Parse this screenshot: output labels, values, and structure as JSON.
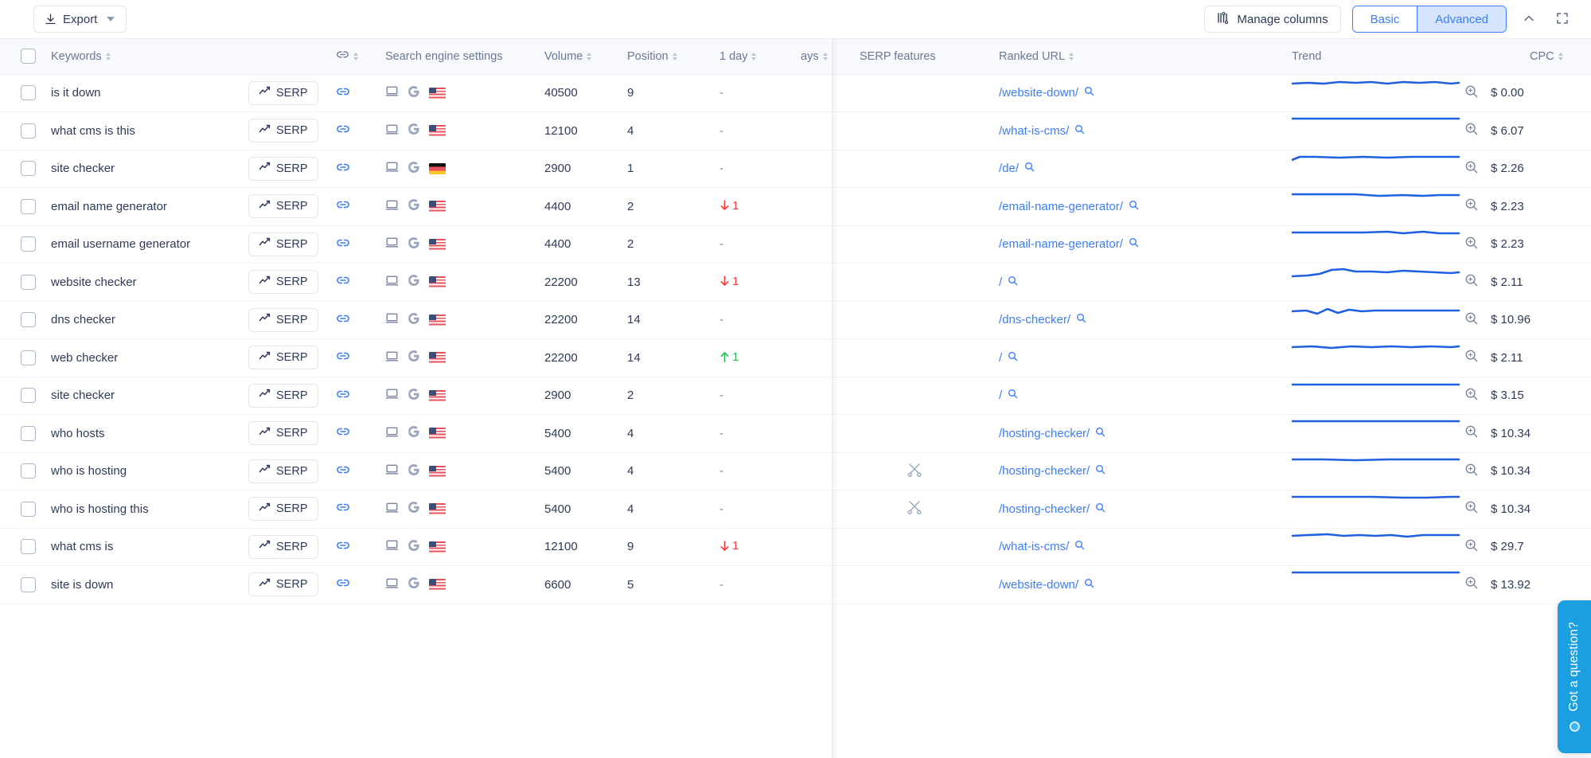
{
  "toolbar": {
    "export_label": "Export",
    "manage_columns_label": "Manage columns",
    "view_basic_label": "Basic",
    "view_advanced_label": "Advanced",
    "active_view": "Advanced",
    "collapse_title": "Collapse",
    "fullscreen_title": "Fullscreen",
    "accent_color": "#3b7dfb",
    "accent_bg": "#d6e4fe"
  },
  "table": {
    "columns": [
      {
        "key": "checkbox",
        "label": "",
        "sortable": false
      },
      {
        "key": "keywords",
        "label": "Keywords",
        "sortable": true
      },
      {
        "key": "serp",
        "label": "",
        "sortable": false
      },
      {
        "key": "link",
        "label": "link-icon",
        "sortable": true
      },
      {
        "key": "search_engine_settings",
        "label": "Search engine settings",
        "sortable": false
      },
      {
        "key": "volume",
        "label": "Volume",
        "sortable": true
      },
      {
        "key": "position",
        "label": "Position",
        "sortable": true
      },
      {
        "key": "one_day",
        "label": "1 day",
        "sortable": true
      },
      {
        "key": "n_days",
        "label": "ays",
        "sortable": true
      },
      {
        "key": "serp_features",
        "label": "SERP features",
        "sortable": false
      },
      {
        "key": "ranked_url",
        "label": "Ranked URL",
        "sortable": true
      },
      {
        "key": "trend",
        "label": "Trend",
        "sortable": false
      },
      {
        "key": "cpc",
        "label": "CPC",
        "sortable": true
      }
    ],
    "serp_button_label": "SERP",
    "rows": [
      {
        "keyword": "is it down",
        "device": "desktop",
        "engine": "G",
        "country": "us",
        "volume": "40500",
        "position": "9",
        "one_day": "-",
        "dir": "none",
        "serp_features": "",
        "url": "/website-down/",
        "cpc": "$ 0.00",
        "trend": "0,9 20,8 40,9 60,7 80,8 100,7 120,9 140,7 160,8 180,7 200,9 210,8"
      },
      {
        "keyword": "what cms is this",
        "device": "desktop",
        "engine": "G",
        "country": "us",
        "volume": "12100",
        "position": "4",
        "one_day": "-",
        "dir": "none",
        "serp_features": "",
        "url": "/what-is-cms/",
        "cpc": "$ 6.07",
        "trend": "0,6 30,6 60,6 90,6 120,6 150,6 180,6 210,6"
      },
      {
        "keyword": "site checker",
        "device": "desktop",
        "engine": "G",
        "country": "de",
        "volume": "2900",
        "position": "1",
        "one_day": "-",
        "dir": "none",
        "serp_features": "",
        "url": "/de/",
        "cpc": "$ 2.26",
        "trend": "0,10 10,6 30,6 60,7 90,6 120,7 150,6 180,6 210,6"
      },
      {
        "keyword": "email name generator",
        "device": "desktop",
        "engine": "G",
        "country": "us",
        "volume": "4400",
        "position": "2",
        "one_day": "1",
        "dir": "down",
        "serp_features": "",
        "url": "/email-name-generator/",
        "cpc": "$ 2.23",
        "trend": "0,6 40,6 80,6 110,8 140,7 165,8 185,7 210,7"
      },
      {
        "keyword": "email username generator",
        "device": "desktop",
        "engine": "G",
        "country": "us",
        "volume": "4400",
        "position": "2",
        "one_day": "-",
        "dir": "none",
        "serp_features": "",
        "url": "/email-name-generator/",
        "cpc": "$ 2.23",
        "trend": "0,6 50,6 90,6 120,5 140,7 165,5 185,7 210,7"
      },
      {
        "keyword": "website checker",
        "device": "desktop",
        "engine": "G",
        "country": "us",
        "volume": "22200",
        "position": "13",
        "one_day": "1",
        "dir": "down",
        "serp_features": "",
        "url": "/",
        "cpc": "$ 2.11",
        "trend": "0,14 20,13 35,11 50,6 65,5 80,8 100,8 120,9 140,7 160,8 180,9 200,10 210,9"
      },
      {
        "keyword": "dns checker",
        "device": "desktop",
        "engine": "G",
        "country": "us",
        "volume": "22200",
        "position": "14",
        "one_day": "-",
        "dir": "none",
        "serp_features": "",
        "url": "/dns-checker/",
        "cpc": "$ 10.96",
        "trend": "0,10 18,9 32,13 45,7 58,12 72,8 88,10 105,9 125,9 150,9 175,9 200,9 210,9"
      },
      {
        "keyword": "web checker",
        "device": "desktop",
        "engine": "G",
        "country": "us",
        "volume": "22200",
        "position": "14",
        "one_day": "1",
        "dir": "up",
        "serp_features": "",
        "url": "/",
        "cpc": "$ 2.11",
        "trend": "0,8 25,7 50,9 75,7 100,8 125,7 150,8 175,7 200,8 210,7"
      },
      {
        "keyword": "site checker",
        "device": "desktop",
        "engine": "G",
        "country": "us",
        "volume": "2900",
        "position": "2",
        "one_day": "-",
        "dir": "none",
        "serp_features": "",
        "url": "/",
        "cpc": "$ 3.15",
        "trend": "0,7 40,7 80,7 120,7 160,7 200,7 210,7"
      },
      {
        "keyword": "who hosts",
        "device": "desktop",
        "engine": "G",
        "country": "us",
        "volume": "5400",
        "position": "4",
        "one_day": "-",
        "dir": "none",
        "serp_features": "",
        "url": "/hosting-checker/",
        "cpc": "$ 10.34",
        "trend": "0,6 50,6 100,6 150,6 200,6 210,6"
      },
      {
        "keyword": "who is hosting",
        "device": "desktop",
        "engine": "G",
        "country": "us",
        "volume": "5400",
        "position": "4",
        "one_day": "-",
        "dir": "none",
        "serp_features": "scissors",
        "url": "/hosting-checker/",
        "cpc": "$ 10.34",
        "trend": "0,6 40,6 80,7 120,6 160,6 200,6 210,6"
      },
      {
        "keyword": "who is hosting this",
        "device": "desktop",
        "engine": "G",
        "country": "us",
        "volume": "5400",
        "position": "4",
        "one_day": "-",
        "dir": "none",
        "serp_features": "scissors",
        "url": "/hosting-checker/",
        "cpc": "$ 10.34",
        "trend": "0,6 50,6 100,6 140,7 170,7 200,6 210,6"
      },
      {
        "keyword": "what cms is",
        "device": "desktop",
        "engine": "G",
        "country": "us",
        "volume": "12100",
        "position": "9",
        "one_day": "1",
        "dir": "down",
        "serp_features": "",
        "url": "/what-is-cms/",
        "cpc": "$ 29.7",
        "trend": "0,7 20,6 45,5 65,7 85,6 105,7 125,6 145,8 165,6 185,6 205,6 210,6"
      },
      {
        "keyword": "site is down",
        "device": "desktop",
        "engine": "G",
        "country": "us",
        "volume": "6600",
        "position": "5",
        "one_day": "-",
        "dir": "none",
        "serp_features": "",
        "url": "/website-down/",
        "cpc": "$ 13.92",
        "trend": "0,6 50,6 100,6 150,6 200,6 210,6"
      }
    ]
  },
  "chat_widget": {
    "label": "Got a question?",
    "color": "#1b9fe0"
  }
}
